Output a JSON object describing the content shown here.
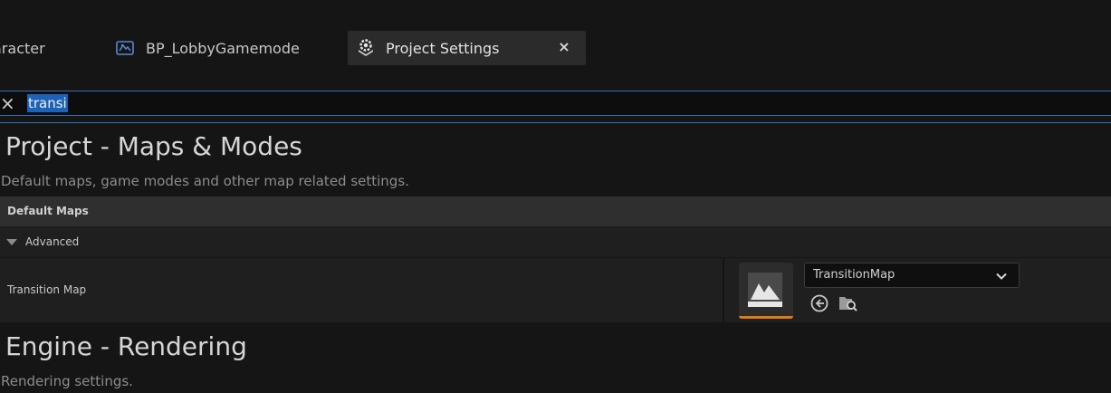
{
  "tabs": [
    {
      "label": "aracter",
      "icon": "none"
    },
    {
      "label": "BP_LobbyGamemode",
      "icon": "blueprint-icon"
    },
    {
      "label": "Project Settings",
      "icon": "settings-icon",
      "active": true,
      "close": "×"
    }
  ],
  "search": {
    "value": "transi",
    "clear_icon": "×"
  },
  "sections": [
    {
      "title": "Project - Maps & Modes",
      "description": "Default maps, game modes and other map related settings."
    },
    {
      "title": "Engine - Rendering",
      "description": "Rendering settings."
    }
  ],
  "category": {
    "header": "Default Maps",
    "advanced_label": "Advanced"
  },
  "property": {
    "name": "Transition Map",
    "selected_value": "TransitionMap",
    "thumbnail_icon": "map-asset-icon",
    "accent_color": "#e07b12"
  },
  "colors": {
    "selection": "#1e62b8",
    "focus_border": "#2f6fb5"
  }
}
